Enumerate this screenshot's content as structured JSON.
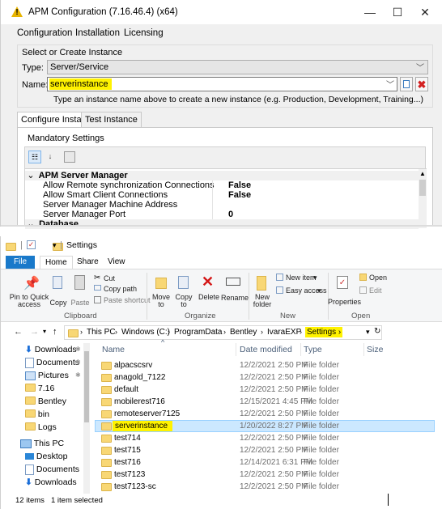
{
  "apm": {
    "title": "APM Configuration (7.16.46.4) (x64)",
    "window_controls": {
      "minimize": "—",
      "maximize": "☐",
      "close": "✕"
    },
    "menu": [
      "Configuration",
      "Installation",
      "Licensing"
    ],
    "instance_group_label": "Select or Create Instance",
    "type_label": "Type:",
    "type_value": "Server/Service",
    "name_label": "Name:",
    "name_value": "serverinstance",
    "hint": "Type an instance name above to create a new instance (e.g. Production, Development, Training...)",
    "tabs": [
      "Configure Instance",
      "Test Instance"
    ],
    "mandatory_label": "Mandatory Settings",
    "grid": {
      "category1": "APM Server Manager",
      "rows": [
        {
          "name": "Allow Remote synchronization Connections",
          "value": "False"
        },
        {
          "name": "Allow Smart Client Connections",
          "value": "False"
        },
        {
          "name": "Server Manager Machine Address",
          "value": ""
        },
        {
          "name": "Server Manager Port",
          "value": "0"
        }
      ],
      "category2": "Database"
    },
    "accent_color": "#fff200"
  },
  "explorer": {
    "title": "Settings",
    "ribbon_tabs": [
      "File",
      "Home",
      "Share",
      "View"
    ],
    "clipboard": {
      "pin": "Pin to Quick access",
      "copy": "Copy",
      "paste": "Paste",
      "cut": "Cut",
      "copy_path": "Copy path",
      "paste_shortcut": "Paste shortcut",
      "group": "Clipboard"
    },
    "organize": {
      "move_to": "Move to",
      "copy_to": "Copy to",
      "delete": "Delete",
      "rename": "Rename",
      "group": "Organize"
    },
    "new": {
      "new_folder": "New folder",
      "new_item": "New item",
      "easy_access": "Easy access",
      "group": "New"
    },
    "open": {
      "properties": "Properties",
      "open": "Open",
      "edit": "Edit",
      "group": "Open"
    },
    "address": [
      "This PC",
      "Windows (C:)",
      "ProgramData",
      "Bentley",
      "IvaraEXP",
      "Settings"
    ],
    "columns": {
      "name": "Name",
      "date": "Date modified",
      "type": "Type",
      "size": "Size"
    },
    "nav": [
      {
        "label": "Downloads",
        "icon": "download-icon",
        "pin": true
      },
      {
        "label": "Documents",
        "icon": "document-icon",
        "pin": true
      },
      {
        "label": "Pictures",
        "icon": "pictures-icon",
        "pin": true
      },
      {
        "label": "7.16",
        "icon": "folder-icon"
      },
      {
        "label": "Bentley",
        "icon": "folder-icon"
      },
      {
        "label": "bin",
        "icon": "folder-icon"
      },
      {
        "label": "Logs",
        "icon": "folder-icon"
      },
      {
        "label": "This PC",
        "icon": "computer-icon"
      },
      {
        "label": "Desktop",
        "icon": "desktop-icon"
      },
      {
        "label": "Documents",
        "icon": "document-icon"
      },
      {
        "label": "Downloads",
        "icon": "download-icon"
      }
    ],
    "files": [
      {
        "name": "alpacscsrv",
        "date": "12/2/2021 2:50 PM",
        "type": "File folder"
      },
      {
        "name": "anagold_7122",
        "date": "12/2/2021 2:50 PM",
        "type": "File folder"
      },
      {
        "name": "default",
        "date": "12/2/2021 2:50 PM",
        "type": "File folder"
      },
      {
        "name": "mobilerest716",
        "date": "12/15/2021 4:45 PM",
        "type": "File folder"
      },
      {
        "name": "remoteserver7125",
        "date": "12/2/2021 2:50 PM",
        "type": "File folder"
      },
      {
        "name": "serverinstance",
        "date": "1/20/2022 8:27 PM",
        "type": "File folder",
        "selected": true
      },
      {
        "name": "test714",
        "date": "12/2/2021 2:50 PM",
        "type": "File folder"
      },
      {
        "name": "test715",
        "date": "12/2/2021 2:50 PM",
        "type": "File folder"
      },
      {
        "name": "test716",
        "date": "12/14/2021 6:31 PM",
        "type": "File folder"
      },
      {
        "name": "test7123",
        "date": "12/2/2021 2:50 PM",
        "type": "File folder"
      },
      {
        "name": "test7123-sc",
        "date": "12/2/2021 2:50 PM",
        "type": "File folder"
      }
    ],
    "status": {
      "count": "12 items",
      "selected": "1 item selected"
    }
  }
}
